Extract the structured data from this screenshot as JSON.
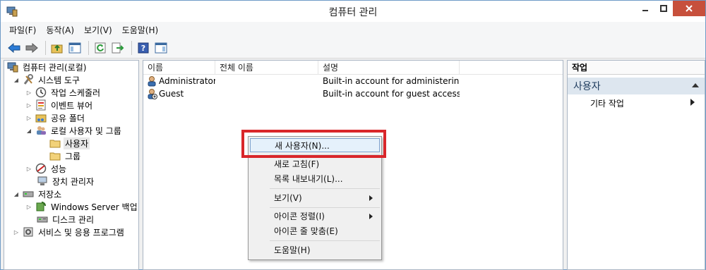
{
  "window": {
    "title": "컴퓨터 관리"
  },
  "menubar": [
    "파일(F)",
    "동작(A)",
    "보기(V)",
    "도움말(H)"
  ],
  "tree": [
    {
      "label": "컴퓨터 관리(로컬)"
    },
    {
      "label": "시스템 도구"
    },
    {
      "label": "작업 스케줄러"
    },
    {
      "label": "이벤트 뷰어"
    },
    {
      "label": "공유 폴더"
    },
    {
      "label": "로컬 사용자 및 그룹"
    },
    {
      "label": "사용자"
    },
    {
      "label": "그룹"
    },
    {
      "label": "성능"
    },
    {
      "label": "장치 관리자"
    },
    {
      "label": "저장소"
    },
    {
      "label": "Windows Server 백업"
    },
    {
      "label": "디스크 관리"
    },
    {
      "label": "서비스 및 응용 프로그램"
    }
  ],
  "list": {
    "columns": [
      "이름",
      "전체 이름",
      "설명"
    ],
    "rows": [
      {
        "name": "Administrator",
        "full_name": "",
        "description": "Built-in account for administerin..."
      },
      {
        "name": "Guest",
        "full_name": "",
        "description": "Built-in account for guest access..."
      }
    ]
  },
  "actions": {
    "header": "작업",
    "group": "사용자",
    "item": "기타 작업"
  },
  "context_menu": {
    "items": [
      "새 사용자(N)...",
      "새로 고침(F)",
      "목록 내보내기(L)...",
      "보기(V)",
      "아이콘 정렬(I)",
      "아이콘 줄 맞춤(E)",
      "도움말(H)"
    ]
  },
  "colors": {
    "highlight": "#d9262a",
    "accent": "#1f3c5e"
  }
}
